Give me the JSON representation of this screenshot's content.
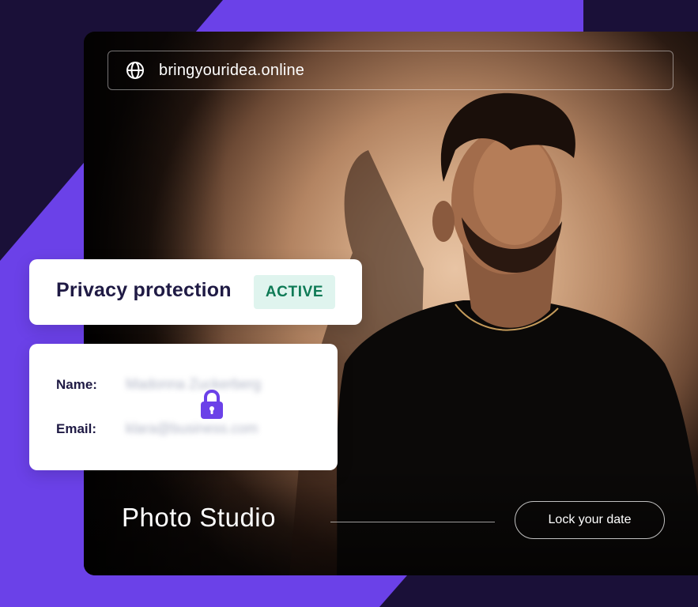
{
  "browser": {
    "url": "bringyouridea.online",
    "icon": "globe-icon"
  },
  "studio": {
    "title": "Photo Studio",
    "cta_label": "Lock your date"
  },
  "privacy": {
    "title": "Privacy protection",
    "status": "ACTIVE",
    "status_color": "#0d7a55"
  },
  "details": {
    "name_label": "Name:",
    "name_value": "Madonna Zuckerberg",
    "email_label": "Email:",
    "email_value": "klara@business.com",
    "lock_icon": "padlock-icon"
  },
  "colors": {
    "accent": "#6b41e8",
    "dark": "#1a1038"
  }
}
